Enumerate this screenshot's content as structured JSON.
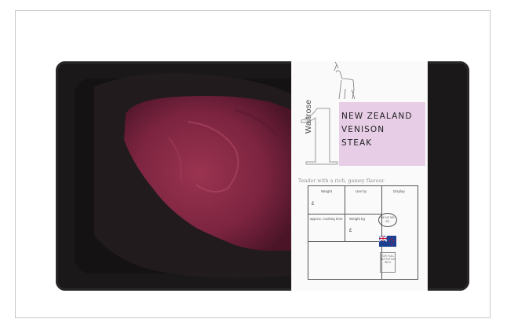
{
  "product": {
    "brand": "Waitrose",
    "brand_number": "1",
    "name_lines": [
      "NEW ZEALAND",
      "VENISON",
      "STEAK"
    ],
    "tagline": "Tender with a rich, gamey flavour",
    "label_headers": [
      "Weight",
      "Use by",
      "Display"
    ],
    "label_row2_headers": [
      "approx. cooking time",
      "Weight kg",
      ""
    ],
    "label_values": [
      "£",
      "£"
    ],
    "oval_text": "UK NZ 001 EC",
    "badge_text": "FOR FULL NUTRITION INFO"
  },
  "colors": {
    "label_pink": "#e7cde6",
    "tray": "#1a1818",
    "meat": "#8a2a45"
  }
}
